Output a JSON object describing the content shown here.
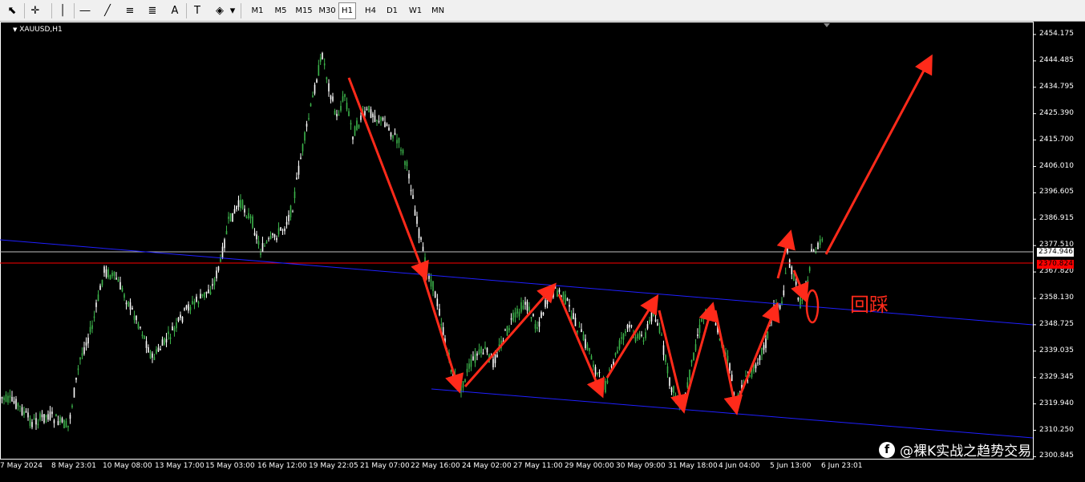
{
  "toolbar": {
    "tools": [
      {
        "name": "cursor-tool",
        "glyph": "⬉"
      },
      {
        "name": "crosshair-tool",
        "glyph": "✛"
      },
      {
        "name": "vertical-line-tool",
        "glyph": "│"
      },
      {
        "name": "horizontal-line-tool",
        "glyph": "―"
      },
      {
        "name": "trendline-tool",
        "glyph": "╱"
      },
      {
        "name": "equidistant-channel-tool",
        "glyph": "≡"
      },
      {
        "name": "fibonacci-tool",
        "glyph": "≣"
      },
      {
        "name": "text-tool",
        "glyph": "A"
      },
      {
        "name": "text-label-tool",
        "glyph": "T"
      },
      {
        "name": "shapes-tool",
        "glyph": "◈"
      },
      {
        "name": "dropdown-arrow",
        "glyph": "▾"
      }
    ],
    "timeframes": [
      "M1",
      "M5",
      "M15",
      "M30",
      "H1",
      "H4",
      "D1",
      "W1",
      "MN"
    ],
    "active_timeframe": "H1"
  },
  "chart": {
    "symbol": "XAUUSD,H1",
    "price_axis": [
      "2454.175",
      "2444.485",
      "2434.795",
      "2425.390",
      "2415.700",
      "2406.010",
      "2396.605",
      "2386.915",
      "2377.510",
      "2367.820",
      "2358.130",
      "2348.725",
      "2339.035",
      "2329.345",
      "2319.940",
      "2310.250",
      "2300.845"
    ],
    "current_price": "2374.946",
    "red_level_price": "2370.824",
    "date_axis": [
      "7 May 2024",
      "8 May 23:01",
      "10 May 08:00",
      "13 May 17:00",
      "15 May 03:00",
      "16 May 12:00",
      "19 May 22:05",
      "21 May 07:00",
      "22 May 16:00",
      "24 May 02:00",
      "27 May 11:00",
      "29 May 00:00",
      "30 May 09:00",
      "31 May 18:00",
      "4 Jun 04:00",
      "5 Jun 13:00",
      "6 Jun 23:01"
    ],
    "annotation_text": "回踩",
    "watermark": "@裸K实战之趋势交易",
    "colors": {
      "background": "#000000",
      "bull_candle": "#3cb44b",
      "bear_candle": "#ffffff",
      "channel_line": "#1f1fff",
      "annotation": "#ff2a1a",
      "grid_line_gray": "#c0c0c0",
      "level_line_red": "#ff0000"
    }
  }
}
